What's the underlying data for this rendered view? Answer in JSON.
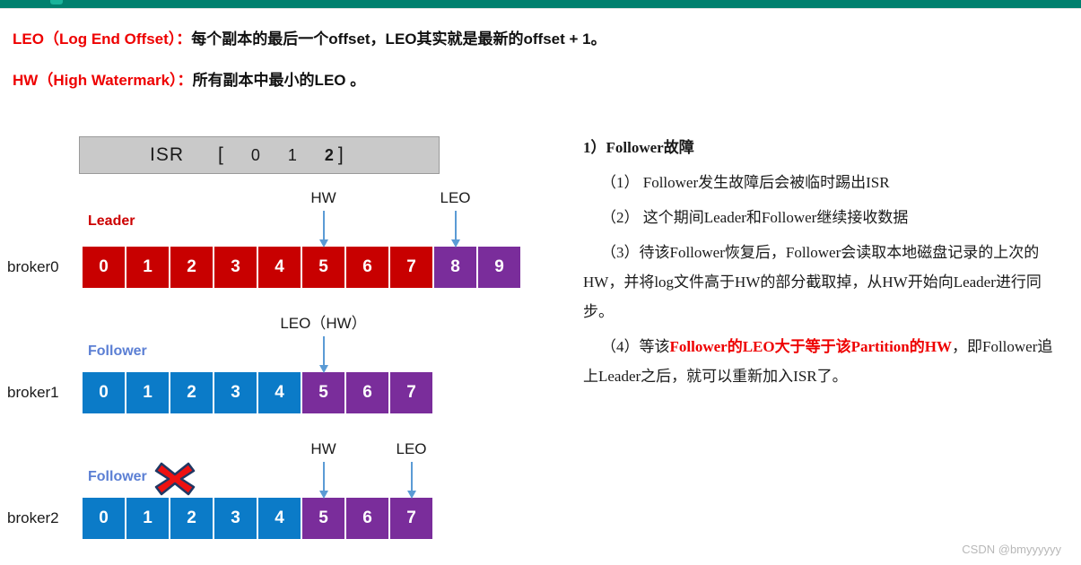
{
  "top_bar": {
    "color": "#00806e"
  },
  "definitions": [
    {
      "term": "LEO（Log End Offset）：",
      "body": "每个副本的最后一个offset，LEO其实就是最新的offset + 1。"
    },
    {
      "term": "HW（High Watermark）：",
      "body": "所有副本中最小的LEO 。"
    }
  ],
  "isr": {
    "label": "ISR",
    "bracket_open": "[",
    "bracket_close": "]",
    "members": [
      "0",
      "1",
      "2"
    ]
  },
  "brokers": [
    {
      "name": "broker0",
      "role_label": "Leader",
      "role_color": "#cc0000",
      "failed": false,
      "cells": [
        {
          "value": "0",
          "color": "red"
        },
        {
          "value": "1",
          "color": "red"
        },
        {
          "value": "2",
          "color": "red"
        },
        {
          "value": "3",
          "color": "red"
        },
        {
          "value": "4",
          "color": "red"
        },
        {
          "value": "5",
          "color": "red"
        },
        {
          "value": "6",
          "color": "red"
        },
        {
          "value": "7",
          "color": "red"
        },
        {
          "value": "8",
          "color": "purple"
        },
        {
          "value": "9",
          "color": "purple"
        }
      ],
      "markers": [
        {
          "caption": "HW",
          "cell_index": 5
        },
        {
          "caption": "LEO",
          "cell_index": 8
        }
      ]
    },
    {
      "name": "broker1",
      "role_label": "Follower",
      "role_color": "#5b7fd4",
      "failed": false,
      "cells": [
        {
          "value": "0",
          "color": "blue"
        },
        {
          "value": "1",
          "color": "blue"
        },
        {
          "value": "2",
          "color": "blue"
        },
        {
          "value": "3",
          "color": "blue"
        },
        {
          "value": "4",
          "color": "blue"
        },
        {
          "value": "5",
          "color": "purple"
        },
        {
          "value": "6",
          "color": "purple"
        },
        {
          "value": "7",
          "color": "purple"
        }
      ],
      "markers": [
        {
          "caption": "LEO（HW）",
          "cell_index": 5
        }
      ]
    },
    {
      "name": "broker2",
      "role_label": "Follower",
      "role_color": "#5b7fd4",
      "failed": true,
      "cells": [
        {
          "value": "0",
          "color": "blue"
        },
        {
          "value": "1",
          "color": "blue"
        },
        {
          "value": "2",
          "color": "blue"
        },
        {
          "value": "3",
          "color": "blue"
        },
        {
          "value": "4",
          "color": "blue"
        },
        {
          "value": "5",
          "color": "purple"
        },
        {
          "value": "6",
          "color": "purple"
        },
        {
          "value": "7",
          "color": "purple"
        }
      ],
      "markers": [
        {
          "caption": "HW",
          "cell_index": 5
        },
        {
          "caption": "LEO",
          "cell_index": 7
        }
      ]
    }
  ],
  "notes": {
    "title": "1）Follower故障",
    "items": [
      {
        "text": "（1） Follower发生故障后会被临时踢出ISR"
      },
      {
        "text": "（2） 这个期间Leader和Follower继续接收数据"
      },
      {
        "text": "（3）待该Follower恢复后，Follower会读取本地磁盘记录的上次的HW，并将log文件高于HW的部分截取掉，从HW开始向Leader进行同步。"
      },
      {
        "prefix": "（4）等该",
        "highlight": "Follower的LEO大于等于该Partition的HW",
        "suffix": "，即Follower追上Leader之后，就可以重新加入ISR了。"
      }
    ]
  },
  "watermark": "CSDN @bmyyyyyy",
  "palette": {
    "red_cell": "#c80000",
    "blue_cell": "#0b7bc8",
    "purple_cell": "#7a2d9b",
    "arrow": "#5b9bd5",
    "isr_bg": "#c9c9c9"
  }
}
